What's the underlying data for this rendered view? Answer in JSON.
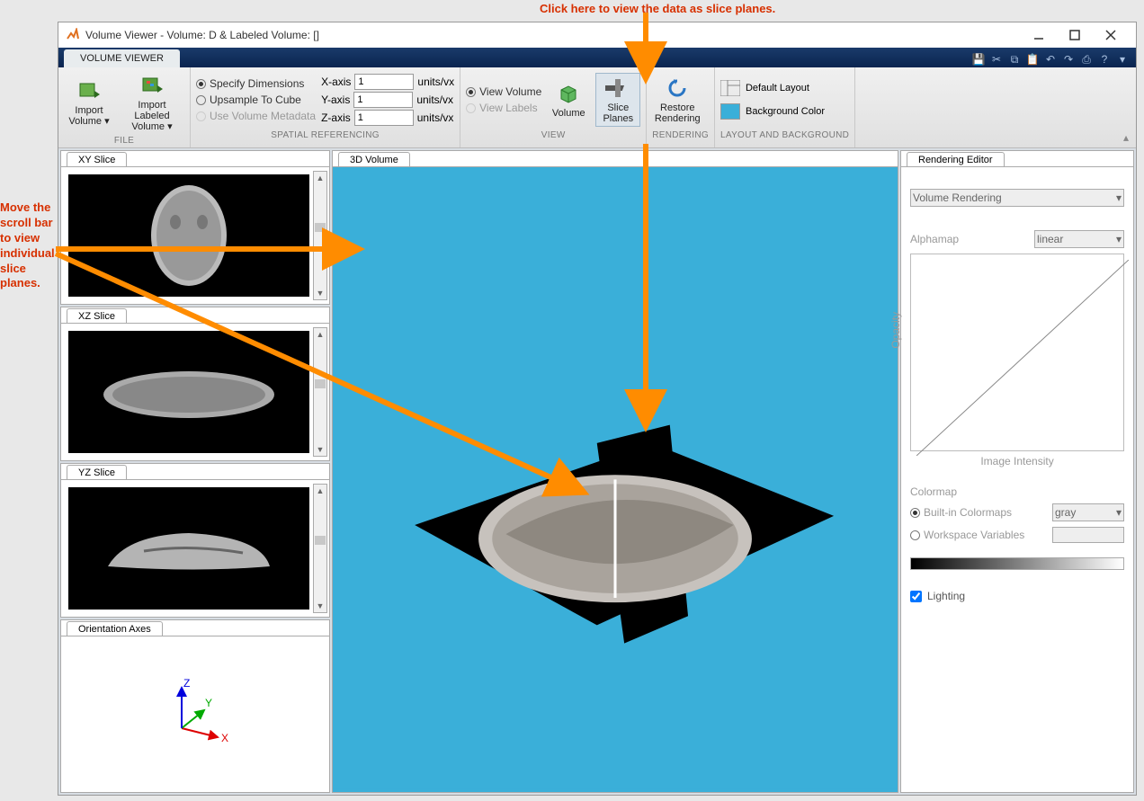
{
  "annotations": {
    "top": "Click here to view the data as slice planes.",
    "left": "Move the scroll bar to view individual slice planes."
  },
  "window": {
    "title": "Volume Viewer - Volume: D & Labeled Volume: []"
  },
  "ribbon": {
    "tab": "VOLUME VIEWER"
  },
  "toolstrip": {
    "file": {
      "label": "FILE",
      "import_volume": "Import Volume ▾",
      "import_labeled": "Import Labeled Volume ▾"
    },
    "spatial": {
      "label": "SPATIAL REFERENCING",
      "specify": "Specify Dimensions",
      "upsample": "Upsample To Cube",
      "metadata": "Use Volume Metadata",
      "xaxis": "X-axis",
      "yaxis": "Y-axis",
      "zaxis": "Z-axis",
      "x": "1",
      "y": "1",
      "z": "1",
      "units": "units/vx"
    },
    "view": {
      "label": "VIEW",
      "volume": "View Volume",
      "labels": "View Labels",
      "vol_btn": "Volume",
      "slice_btn": "Slice Planes"
    },
    "rendering": {
      "label": "RENDERING",
      "restore": "Restore Rendering"
    },
    "layout": {
      "label": "LAYOUT AND BACKGROUND",
      "default": "Default Layout",
      "bg": "Background Color"
    }
  },
  "panels": {
    "xy": "XY Slice",
    "xz": "XZ Slice",
    "yz": "YZ Slice",
    "orient": "Orientation Axes",
    "vol3d": "3D Volume",
    "rend_ed": "Rendering Editor"
  },
  "rendering_editor": {
    "mode": "Volume Rendering",
    "alphamap_label": "Alphamap",
    "alphamap_value": "linear",
    "opacity": "Opacity",
    "intensity": "Image Intensity",
    "colormap": "Colormap",
    "builtin": "Built-in Colormaps",
    "builtin_value": "gray",
    "workspace": "Workspace Variables",
    "lighting": "Lighting"
  },
  "axes": {
    "x": "X",
    "y": "Y",
    "z": "Z"
  }
}
